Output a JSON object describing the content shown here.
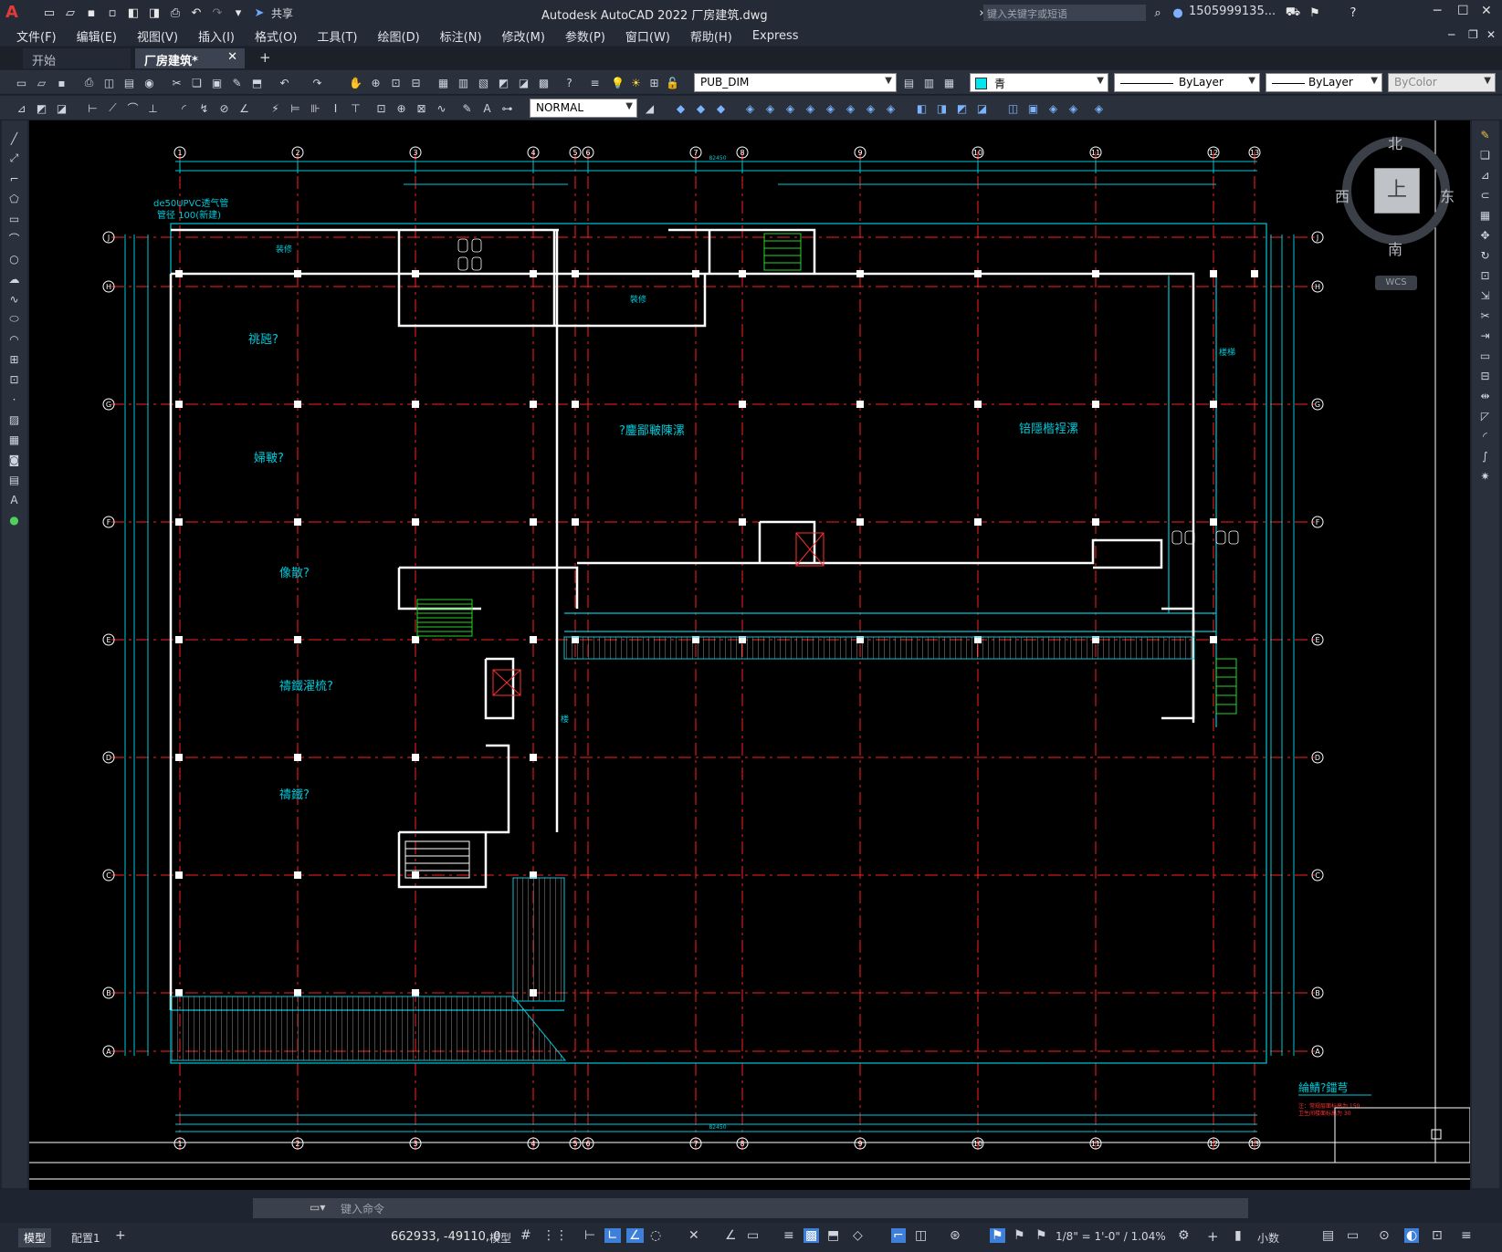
{
  "app": {
    "title": "Autodesk AutoCAD 2022    厂房建筑.dwg",
    "logo": "A",
    "search_placeholder": "键入关键字或短语",
    "user": "1505999135...",
    "share_label": "共享"
  },
  "menu": [
    "文件(F)",
    "编辑(E)",
    "视图(V)",
    "插入(I)",
    "格式(O)",
    "工具(T)",
    "绘图(D)",
    "标注(N)",
    "修改(M)",
    "参数(P)",
    "窗口(W)",
    "帮助(H)",
    "Express"
  ],
  "tabs": {
    "start": "开始",
    "file": "厂房建筑*",
    "close": "✕",
    "add": "+"
  },
  "toolbar": {
    "layer_name": "PUB_DIM",
    "color_name": "青",
    "linetype": "ByLayer",
    "lineweight": "ByLayer",
    "plotstyle": "ByColor",
    "dimstyle": "NORMAL"
  },
  "viewcube": {
    "north": "北",
    "south": "南",
    "east": "东",
    "west": "西",
    "face": "上",
    "ucs": "WCS"
  },
  "drawing": {
    "grid_top_labels": [
      "1",
      "2",
      "3",
      "4",
      "5",
      "6",
      "7",
      "8",
      "9",
      "10",
      "11",
      "12",
      "13"
    ],
    "grid_side_labels": [
      "J",
      "H",
      "G",
      "F",
      "E",
      "D",
      "C",
      "B",
      "A"
    ],
    "pipe_note_1": "de50UPVC透气管",
    "pipe_note_2": "管径 100(新建)",
    "room_labels": [
      "祧瓲?",
      "婦皸?",
      "像散?",
      "禱鐵濯梳?",
      "禱鐵?",
      "?鏖鄙皸陳漯",
      "锫隱楷裎漯",
      "装修",
      "裝修",
      "楼梯",
      "楼"
    ],
    "overall_dim": "82450",
    "legend_title": "綸鯖?鍿芎",
    "legend_note_1": "注：常规层面标高为 150",
    "legend_note_2": "卫生间楼面标高为 30"
  },
  "command": {
    "placeholder": "键入命令"
  },
  "status": {
    "model_tab": "模型",
    "layout_tab": "配置1",
    "coords": "662933, -49110, 0",
    "model_btn": "模型",
    "scale": "1/8\" = 1'-0\" / 1.04%",
    "units": "小数"
  },
  "colors": {
    "grid": "#ff2020",
    "wall": "#ffffff",
    "dim": "#00c8d8",
    "stair": "#29d429",
    "elevator": "#ff3030",
    "accent": "#3d7fd9"
  }
}
